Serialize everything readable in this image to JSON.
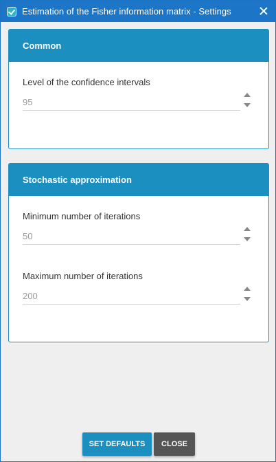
{
  "window": {
    "title": "Estimation of the Fisher information matrix - Settings"
  },
  "panels": [
    {
      "header": "Common",
      "fields": [
        {
          "label": "Level of the confidence intervals",
          "value": "95"
        }
      ]
    },
    {
      "header": "Stochastic approximation",
      "fields": [
        {
          "label": "Minimum number of iterations",
          "value": "50"
        },
        {
          "label": "Maximum number of iterations",
          "value": "200"
        }
      ]
    }
  ],
  "buttons": {
    "set_defaults": "SET DEFAULTS",
    "close": "CLOSE"
  },
  "colors": {
    "titlebar": "#1c75c7",
    "accent": "#1a8fc0",
    "close_button": "#555555"
  }
}
